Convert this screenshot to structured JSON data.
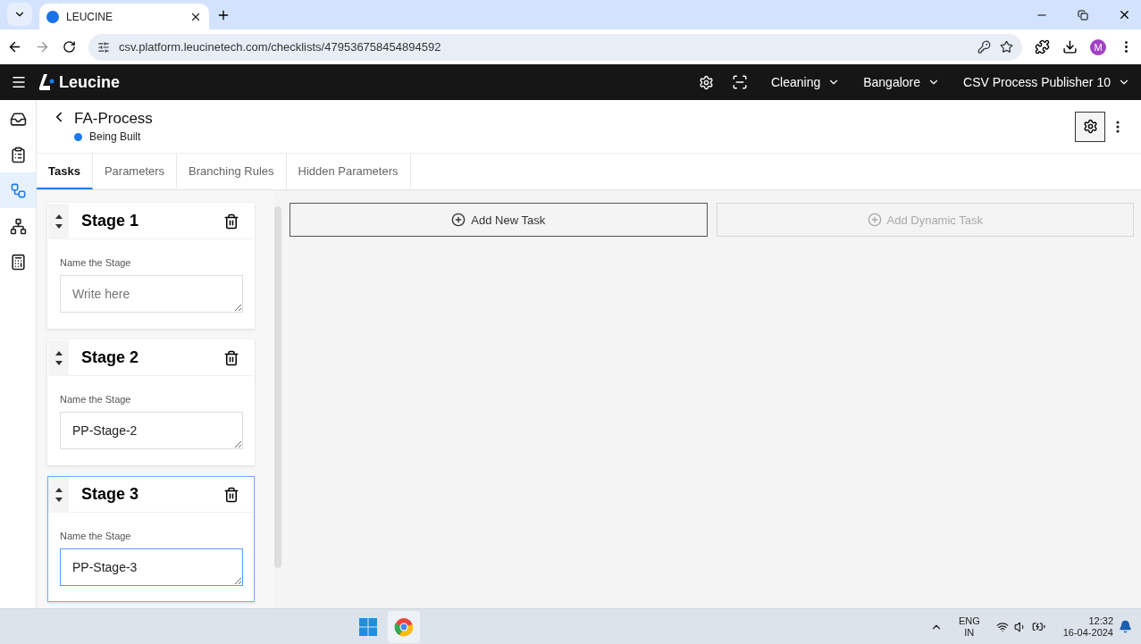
{
  "browser": {
    "tab_title": "LEUCINE",
    "url": "csv.platform.leucinetech.com/checklists/479536758454894592",
    "profile_initial": "M"
  },
  "app_header": {
    "brand": "Leucine",
    "menus": [
      {
        "label": "Cleaning"
      },
      {
        "label": "Bangalore"
      },
      {
        "label": "CSV Process Publisher 10"
      }
    ]
  },
  "sidebar": {
    "items": [
      {
        "selected": false
      },
      {
        "selected": false
      },
      {
        "selected": true
      },
      {
        "selected": false
      },
      {
        "selected": false
      }
    ]
  },
  "process": {
    "title": "FA-Process",
    "status": {
      "label": "Being Built",
      "color": "#1a7cf2"
    }
  },
  "tabs": [
    {
      "label": "Tasks",
      "selected": true
    },
    {
      "label": "Parameters",
      "selected": false
    },
    {
      "label": "Branching Rules",
      "selected": false
    },
    {
      "label": "Hidden Parameters",
      "selected": false
    }
  ],
  "stages": [
    {
      "title": "Stage 1",
      "field_label": "Name the Stage",
      "placeholder": "Write here",
      "selected": false
    },
    {
      "title": "Stage 2",
      "field_label": "Name the Stage",
      "value": "PP-Stage-2",
      "selected": false
    },
    {
      "title": "Stage 3",
      "field_label": "Name the Stage",
      "value": "PP-Stage-3",
      "selected": true
    }
  ],
  "task_actions": [
    {
      "label": "Add New Task",
      "disabled": false
    },
    {
      "label": "Add Dynamic Task",
      "disabled": true
    }
  ],
  "taskbar": {
    "language": "ENG",
    "region": "IN",
    "time": "12:32",
    "date": "16-04-2024"
  }
}
